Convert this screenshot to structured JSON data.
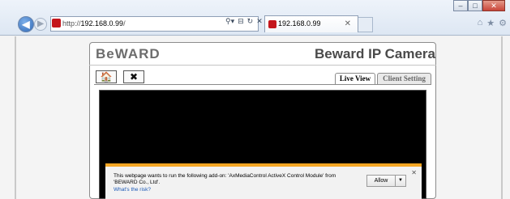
{
  "browser": {
    "address_scheme": "http://",
    "address_host": "192.168.0.99",
    "address_path": "/",
    "address_tools": [
      "⚲▾",
      "⊟",
      "↻",
      "✕"
    ],
    "tab_title": "192.168.0.99",
    "tab_close": "✕",
    "window_controls": [
      "–",
      "□",
      "✕"
    ],
    "right_icons": [
      "⌂",
      "★",
      "⚙"
    ]
  },
  "header": {
    "logo": "BeWARD",
    "title": "Beward IP Camera"
  },
  "toolbar": {
    "home_icon": "🏠",
    "tools_icon": "✖"
  },
  "tabs": {
    "live_view": "Live View",
    "client_setting": "Client Setting"
  },
  "notification": {
    "message": "This webpage wants to run the following add-on: 'AxMediaControl ActiveX Control Module' from 'BEWARD Co., Ltd'.",
    "link": "What's the risk?",
    "allow_label": "Allow",
    "dropdown_glyph": "▼",
    "close_glyph": "✕",
    "accent_color": "#f5a623"
  }
}
